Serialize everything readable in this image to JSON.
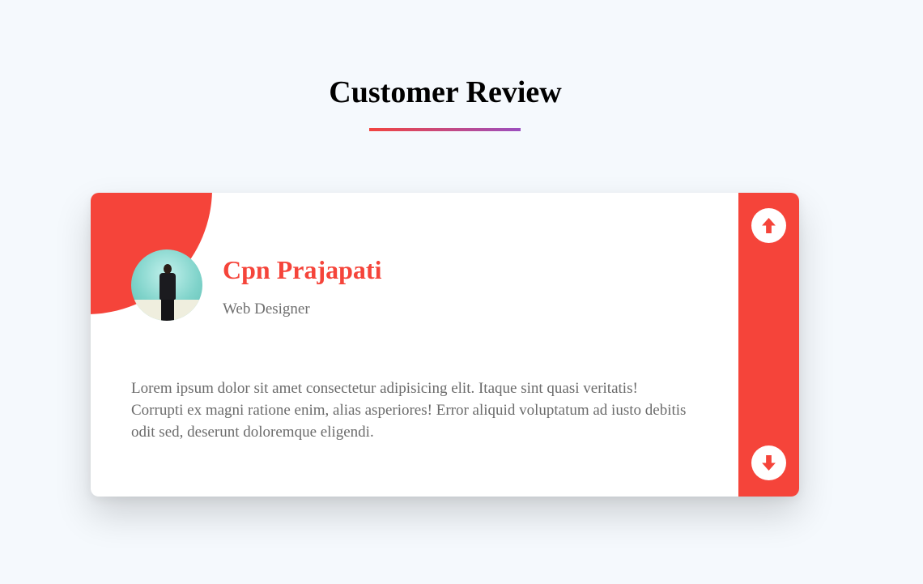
{
  "page": {
    "title": "Customer Review"
  },
  "review": {
    "name": "Cpn Prajapati",
    "role": "Web Designer",
    "text": "Lorem ipsum dolor sit amet consectetur adipisicing elit. Itaque sint quasi veritatis! Corrupti ex magni ratione enim, alias asperiores! Error aliquid voluptatum ad iusto debitis odit sed, deserunt doloremque eligendi."
  },
  "controls": {
    "up_icon": "arrow-up-icon",
    "down_icon": "arrow-down-icon"
  },
  "colors": {
    "accent": "#f5443a",
    "underline_start": "#f2443f",
    "underline_end": "#9b4fbf",
    "background": "#f5f9fd"
  }
}
